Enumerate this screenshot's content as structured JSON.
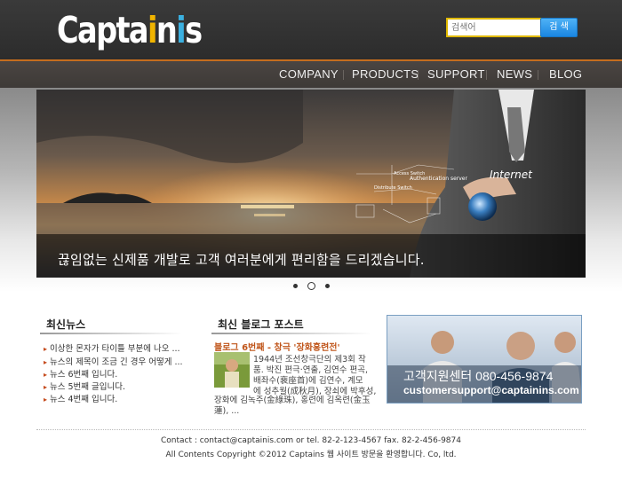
{
  "header": {
    "logo": {
      "part1": "Capta",
      "part2": "i",
      "part3": "n",
      "part4": "i",
      "part5": "s"
    },
    "search": {
      "placeholder": "검색어",
      "button_label": "검 색"
    }
  },
  "nav": {
    "items": [
      {
        "label": "COMPANY"
      },
      {
        "label": "PRODUCTS"
      },
      {
        "label": "SUPPORT"
      },
      {
        "label": "NEWS"
      },
      {
        "label": "BLOG"
      }
    ]
  },
  "hero": {
    "caption": "끊임없는 신제품 개발로 고객 여러분에게 편리함을 드리겠습니다.",
    "overlay_texts": {
      "internet": "Internet",
      "auth": "Authentication server",
      "access": "Access Switch",
      "dist": "Distribute Switch"
    },
    "slides": {
      "count": 3,
      "active_index": 1
    }
  },
  "news": {
    "title": "최신뉴스",
    "items": [
      "이상한 몬자가 타이틀 부분에 나오 ...",
      "뉴스의 제목이 조금 긴 경우 어떻게 ...",
      "뉴스 6번째 입니다.",
      "뉴스 5번째 글입니다.",
      "뉴스 4번째 입니다."
    ]
  },
  "blog": {
    "title": "최신 블로그 포스트",
    "post_title": "블로그 6번째 - 창극 '장화홍련전'",
    "lines": [
      "1944년 조선창극단의 제3회 작",
      "품. 박진 편극·연출, 김연수 편곡,",
      "배좌수(裵座首)에 김연수, 계모",
      "에 성추월(成秋月), 장쇠에 박후성,",
      "장화에 김녹주(金綠珠), 홍련에 김옥련(金玉",
      "蓮), ..."
    ]
  },
  "support_banner": {
    "phone": "고객지원센터 080-456-9874",
    "email": "customersupport@captainins.com"
  },
  "footer": {
    "contact": "Contact : contact@captainis.com or tel. 82-2-123-4567 fax. 82-2-456-9874",
    "copyright": "All Contents Copyright ©2012 Captains 웹 사이트 방문을 환영합니다. Co, ltd."
  },
  "colors": {
    "accent": "#c56d1e",
    "search_button": "#1a86e2",
    "blog_title": "#c0551a"
  }
}
